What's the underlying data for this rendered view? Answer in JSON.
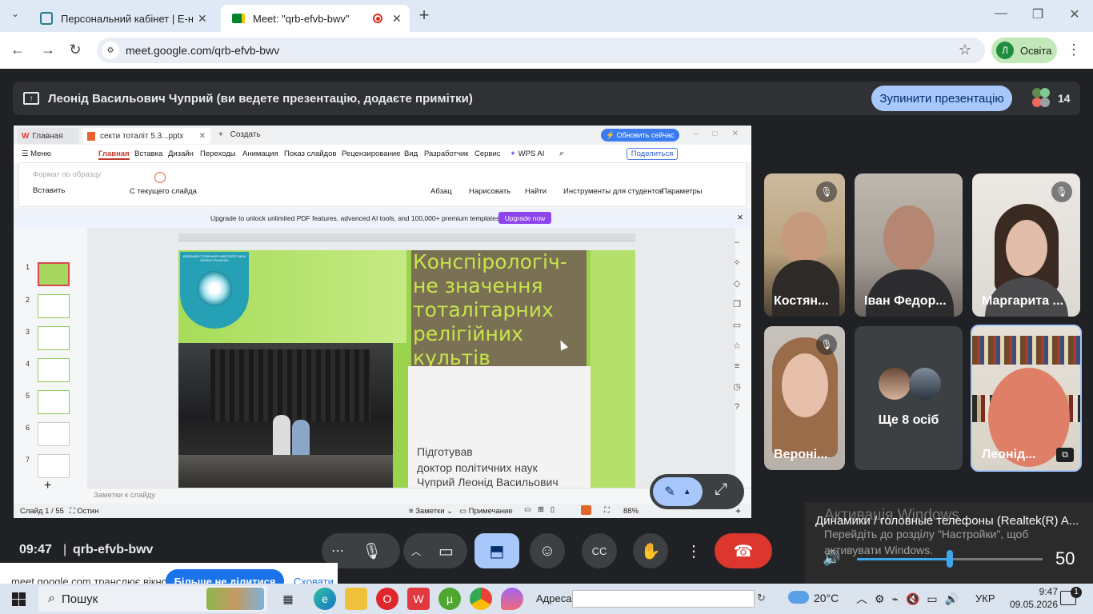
{
  "browser": {
    "tabs": [
      {
        "title": "Персональний кабінет | Е-нав"
      },
      {
        "title": "Meet: \"qrb-efvb-bwv\""
      }
    ],
    "new_tab": "+",
    "url": "meet.google.com/qrb-efvb-bwv",
    "profile_initial": "Л",
    "profile_name": "Освіта"
  },
  "meet": {
    "presenter_text": "Леонід Васильович Чуприй (ви ведете презентацію, додаєте примітки)",
    "stop_button": "Зупинити презентацію",
    "participant_count": "14",
    "participants": [
      {
        "name": "Костян..."
      },
      {
        "name": "Іван Федор..."
      },
      {
        "name": "Маргарита ..."
      },
      {
        "name": "Вероні..."
      },
      {
        "name": "Ще 8 осіб"
      },
      {
        "name": "Леонід..."
      }
    ],
    "time": "09:47",
    "meeting_code": "qrb-efvb-bwv"
  },
  "wps": {
    "tabs": [
      "Главная",
      "секти  тоталіт 5.3...pptx",
      "Создать"
    ],
    "update_btn": "Обновить сейчас",
    "menu": [
      "Меню",
      "Главная",
      "Вставка",
      "Дизайн",
      "Переходы",
      "Анимация",
      "Показ слайдов",
      "Рецензирование",
      "Вид",
      "Разработчик",
      "Сервис",
      "WPS AI"
    ],
    "share": "Поделиться",
    "ribbon": {
      "format_painter": "Формат по образцу",
      "paste": "Вставить",
      "from_current": "С текущего слайда",
      "paragraph": "Абзац",
      "draw": "Нарисовать",
      "find": "Найти",
      "tools_students": "Инструменты для студентов",
      "params": "Параметры"
    },
    "banner_text": "Upgrade to unlock unlimited PDF features, advanced AI tools, and 100,000+ premium templates.",
    "banner_btn": "Upgrade now",
    "slide_numbers": [
      "1",
      "2",
      "3",
      "4",
      "5",
      "6",
      "7"
    ],
    "slide": {
      "title": "Конспірологіч-не значення тоталітарних релігійних культів",
      "author_1": "Підготував",
      "author_2": "доктор політичних наук",
      "author_3": "Чуприй Леонід Васильович",
      "logo_text": "КИЇВСЬКИЙ СТОЛИЧНИЙ УНІВЕРСИТЕТ ІМЕНІ БОРИСА ГРІНЧЕНКА"
    },
    "notes": "Заметки к слайду",
    "status": {
      "slide": "Слайд 1 / 55",
      "theme": "Остин",
      "notes": "Заметки",
      "comment": "Примечание",
      "zoom": "88%"
    }
  },
  "volume": {
    "device": "Динамики / головные телефоны (Realtek(R) A...",
    "level": "50",
    "level_fraction": 0.5,
    "activation_title": "Активація Windows",
    "activation_text": "Перейдіть до розділу \"Настройки\", щоб активувати Windows."
  },
  "notification": {
    "text": "meet.google.com транслює вікно.",
    "button": "Більше не ділитися",
    "hide": "Сховати"
  },
  "taskbar": {
    "search": "Пошук",
    "address_label": "Адреса",
    "weather": "20°C",
    "lang": "УКР",
    "clock_time": "9:47",
    "clock_date": "09.05.2026",
    "notif_count": "1"
  }
}
